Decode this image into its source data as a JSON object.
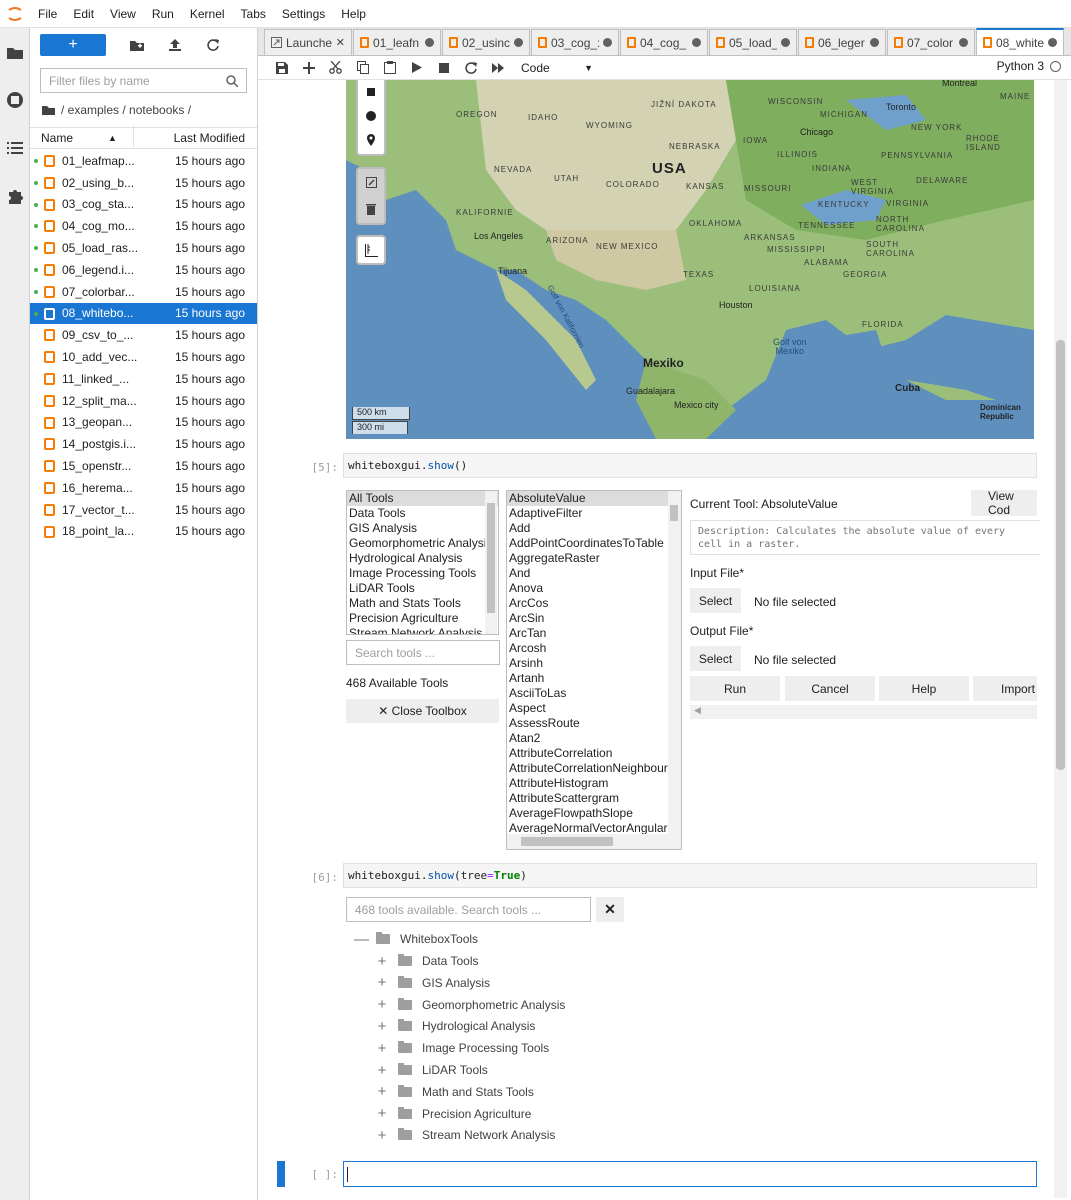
{
  "menubar": {
    "items": [
      "File",
      "Edit",
      "View",
      "Run",
      "Kernel",
      "Tabs",
      "Settings",
      "Help"
    ]
  },
  "leftbar": {
    "icons": [
      "folder-icon",
      "running-icon",
      "toc-icon",
      "extension-icon"
    ]
  },
  "filebrowser": {
    "new_label": "+",
    "filter_placeholder": "Filter files by name",
    "breadcrumb": "/ examples / notebooks /",
    "col_name": "Name",
    "col_modified": "Last Modified",
    "files": [
      {
        "name": "01_leafmap...",
        "modified": "15 hours ago",
        "running": true
      },
      {
        "name": "02_using_b...",
        "modified": "15 hours ago",
        "running": true
      },
      {
        "name": "03_cog_sta...",
        "modified": "15 hours ago",
        "running": true
      },
      {
        "name": "04_cog_mo...",
        "modified": "15 hours ago",
        "running": true
      },
      {
        "name": "05_load_ras...",
        "modified": "15 hours ago",
        "running": true
      },
      {
        "name": "06_legend.i...",
        "modified": "15 hours ago",
        "running": true
      },
      {
        "name": "07_colorbar...",
        "modified": "15 hours ago",
        "running": true
      },
      {
        "name": "08_whitebo...",
        "modified": "15 hours ago",
        "running": true,
        "selected": true
      },
      {
        "name": "09_csv_to_...",
        "modified": "15 hours ago",
        "running": false
      },
      {
        "name": "10_add_vec...",
        "modified": "15 hours ago",
        "running": false
      },
      {
        "name": "11_linked_...",
        "modified": "15 hours ago",
        "running": false
      },
      {
        "name": "12_split_ma...",
        "modified": "15 hours ago",
        "running": false
      },
      {
        "name": "13_geopan...",
        "modified": "15 hours ago",
        "running": false
      },
      {
        "name": "14_postgis.i...",
        "modified": "15 hours ago",
        "running": false
      },
      {
        "name": "15_openstr...",
        "modified": "15 hours ago",
        "running": false
      },
      {
        "name": "16_herema...",
        "modified": "15 hours ago",
        "running": false
      },
      {
        "name": "17_vector_t...",
        "modified": "15 hours ago",
        "running": false
      },
      {
        "name": "18_point_la...",
        "modified": "15 hours ago",
        "running": false
      }
    ]
  },
  "tabs": [
    {
      "label": "Launche",
      "kind": "launcher"
    },
    {
      "label": "01_leafn",
      "kind": "nb"
    },
    {
      "label": "02_usinc",
      "kind": "nb"
    },
    {
      "label": "03_cog_:",
      "kind": "nb"
    },
    {
      "label": "04_cog_",
      "kind": "nb"
    },
    {
      "label": "05_load_",
      "kind": "nb"
    },
    {
      "label": "06_leger",
      "kind": "nb"
    },
    {
      "label": "07_color",
      "kind": "nb"
    },
    {
      "label": "08_white",
      "kind": "nb",
      "active": true
    }
  ],
  "toolbar": {
    "cell_type": "Code",
    "kernel": "Python 3"
  },
  "map": {
    "labels": {
      "usa": "USA",
      "mexiko": "Mexiko",
      "kuba": "Cuba",
      "gulf": "Golf von\nMexiko",
      "kalif": "Golf von Kalifornien",
      "scale_km": "500 km",
      "scale_mi": "300 mi",
      "montreal": "Montreal",
      "toronto": "Toronto",
      "chicago": "Chicago",
      "losangeles": "Los Angeles",
      "tijuana": "Tijuana",
      "houston": "Houston",
      "guadalajara": "Guadalajara",
      "mexicocity": "Mexico city",
      "dominican": "Dominican Republic"
    },
    "states": [
      "OREGON",
      "IDAHO",
      "WYOMING",
      "NEVADA",
      "UTAH",
      "COLORADO",
      "KALIFORNIE",
      "ARIZONA",
      "NEW MEXICO",
      "TEXAS",
      "KANSAS",
      "NEBRASKA",
      "JIŽNÍ DAKOTA",
      "WISCONSIN",
      "MICHIGAN",
      "IOWA",
      "ILLINOIS",
      "INDIANA",
      "MISSOURI",
      "OKLAHOMA",
      "ARKANSAS",
      "TENNESSEE",
      "KENTUCKY",
      "MISSISSIPPI",
      "ALABAMA",
      "GEORGIA",
      "LOUISIANA",
      "FLORIDA",
      "SOUTH CAROLINA",
      "NORTH CAROLINA",
      "VIRGINIA",
      "WEST VIRGINIA",
      "PENNSYLVANIA",
      "NEW YORK",
      "MAINE",
      "RHODE ISLAND",
      "DELAWARE"
    ]
  },
  "cells": {
    "c5": {
      "prompt": "[5]:",
      "obj": "whiteboxgui",
      "method": "show",
      "args": "()"
    },
    "c6": {
      "prompt": "[6]:",
      "obj": "whiteboxgui",
      "method": "show",
      "arg_name": "tree",
      "arg_val": "True"
    },
    "c7": {
      "prompt": "[ ]:"
    }
  },
  "toolbox": {
    "categories": [
      "All Tools",
      "Data Tools",
      "GIS Analysis",
      "Geomorphometric Analysi",
      "Hydrological Analysis",
      "Image Processing Tools",
      "LiDAR Tools",
      "Math and Stats Tools",
      "Precision Agriculture",
      "Stream Network Analysis"
    ],
    "search_placeholder": "Search tools ...",
    "available": "468 Available Tools",
    "close_label": "✕ Close Toolbox",
    "tools": [
      "AbsoluteValue",
      "AdaptiveFilter",
      "Add",
      "AddPointCoordinatesToTable",
      "AggregateRaster",
      "And",
      "Anova",
      "ArcCos",
      "ArcSin",
      "ArcTan",
      "Arcosh",
      "Arsinh",
      "Artanh",
      "AsciiToLas",
      "Aspect",
      "AssessRoute",
      "Atan2",
      "AttributeCorrelation",
      "AttributeCorrelationNeighbourl",
      "AttributeHistogram",
      "AttributeScattergram",
      "AverageFlowpathSlope",
      "AverageNormalVectorAngularl"
    ],
    "current_tool": "Current Tool: AbsoluteValue",
    "view_code": "View Cod",
    "description": "Description: Calculates the absolute value of every cell in a raster.",
    "input_label": "Input File*",
    "output_label": "Output File*",
    "select": "Select",
    "no_file": "No file selected",
    "run": "Run",
    "cancel": "Cancel",
    "help": "Help",
    "import": "Import"
  },
  "tree": {
    "search_placeholder": "468 tools available. Search tools ...",
    "root": "WhiteboxTools",
    "children": [
      "Data Tools",
      "GIS Analysis",
      "Geomorphometric Analysis",
      "Hydrological Analysis",
      "Image Processing Tools",
      "LiDAR Tools",
      "Math and Stats Tools",
      "Precision Agriculture",
      "Stream Network Analysis"
    ]
  }
}
